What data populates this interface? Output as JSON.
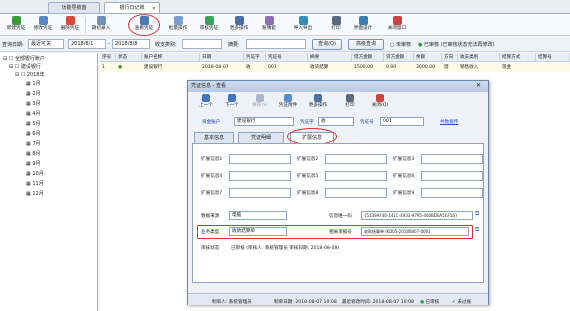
{
  "tabs": [
    {
      "label": "功能导航首"
    },
    {
      "label": "银行日记账"
    }
  ],
  "toolbar": {
    "buttons": [
      {
        "label": "新建凭证"
      },
      {
        "label": "修改凭证"
      },
      {
        "label": "删除凭证"
      },
      {
        "label": "期初录入"
      },
      {
        "label": "查看凭证"
      },
      {
        "label": "批量操作"
      },
      {
        "label": "审核凭证"
      },
      {
        "label": "更多操作"
      },
      {
        "label": "账簿套"
      },
      {
        "label": "导入导出"
      },
      {
        "label": "打印"
      },
      {
        "label": "界面设计"
      },
      {
        "label": "关闭窗口"
      }
    ]
  },
  "filter": {
    "date_label": "查询日期:",
    "date_mode": "最近可关",
    "date_from": "2018/8/1",
    "date_to": "2018/8/8",
    "category_label": "收支类别:",
    "summary_label": "摘要:",
    "query_btn": "查询(Q)",
    "advanced_btn": "高级查询",
    "unaudited": "未审核",
    "audited": "已审核 (已审核状态无法再修改)"
  },
  "tree": {
    "root": "全部银行账户",
    "bank": "建设银行",
    "year": "2018年",
    "months": [
      "1月",
      "2月",
      "3月",
      "4月",
      "5月",
      "6月",
      "7月",
      "8月",
      "9月",
      "10月",
      "11月",
      "12月"
    ]
  },
  "grid": {
    "headers": [
      "序号",
      "状态",
      "账户名称",
      "日期",
      "凭证字",
      "凭证号",
      "摘要",
      "借方金额",
      "贷方金额",
      "余额",
      "方向",
      "收支类别",
      "结算方式",
      "结算号"
    ],
    "row": {
      "no": "1",
      "status": "●",
      "account": "建设银行",
      "date": "2018-08-07",
      "voucher_word": "收",
      "voucher_no": "001",
      "summary": "收货结算",
      "debit": "1500.00",
      "credit": "0.00",
      "balance": "3000.00",
      "direction": "借",
      "category": "销售收入",
      "settlement": "现金",
      "settlement_no": ""
    }
  },
  "dialog": {
    "title": "凭证信息 - 查看",
    "toolbar": [
      {
        "label": "上一个"
      },
      {
        "label": "下一个"
      },
      {
        "label": "保存(S)"
      },
      {
        "label": "凭证附件"
      },
      {
        "label": "更多操作"
      },
      {
        "label": "打印"
      },
      {
        "label": "关闭(Q)"
      }
    ],
    "account_label": "资金账户",
    "account": "建设银行",
    "voucher_word_label": "凭证字",
    "voucher_word": "收",
    "voucher_no_label": "凭证号",
    "voucher_no": "001",
    "shared_text": "共数据传",
    "tabs": [
      {
        "label": "基本信息"
      },
      {
        "label": "凭证明细"
      },
      {
        "label": "扩展信息"
      }
    ],
    "ext_labels": [
      "扩展信息1",
      "扩展信息2",
      "扩展信息3",
      "扩展信息4",
      "扩展信息5",
      "扩展信息6",
      "扩展信息7",
      "扩展信息8",
      "扩展信息9"
    ],
    "source_label": "数据来源",
    "source": "电脑",
    "unique_label": "信息唯一码",
    "unique": "{5139AF40-141C-4933-9795-460BD0A5CF16}",
    "biz_label": "业务类型",
    "biz": "收款结算单",
    "related_label": "相关单据号",
    "related": "收款结算单 IKD05-20180807-0001",
    "audit_label": "审核状态",
    "audit": "已审核 (审核人: 系统管理员 审核日期: 2018-08-08)",
    "maker": "制单人: 系统管理员",
    "make_date": "制单日期: 2018-08-07 10:08",
    "edit_date": "最近修改时间: 2018-08-07 10:08",
    "status_audited": "已审核",
    "status_unused": "未过账"
  }
}
